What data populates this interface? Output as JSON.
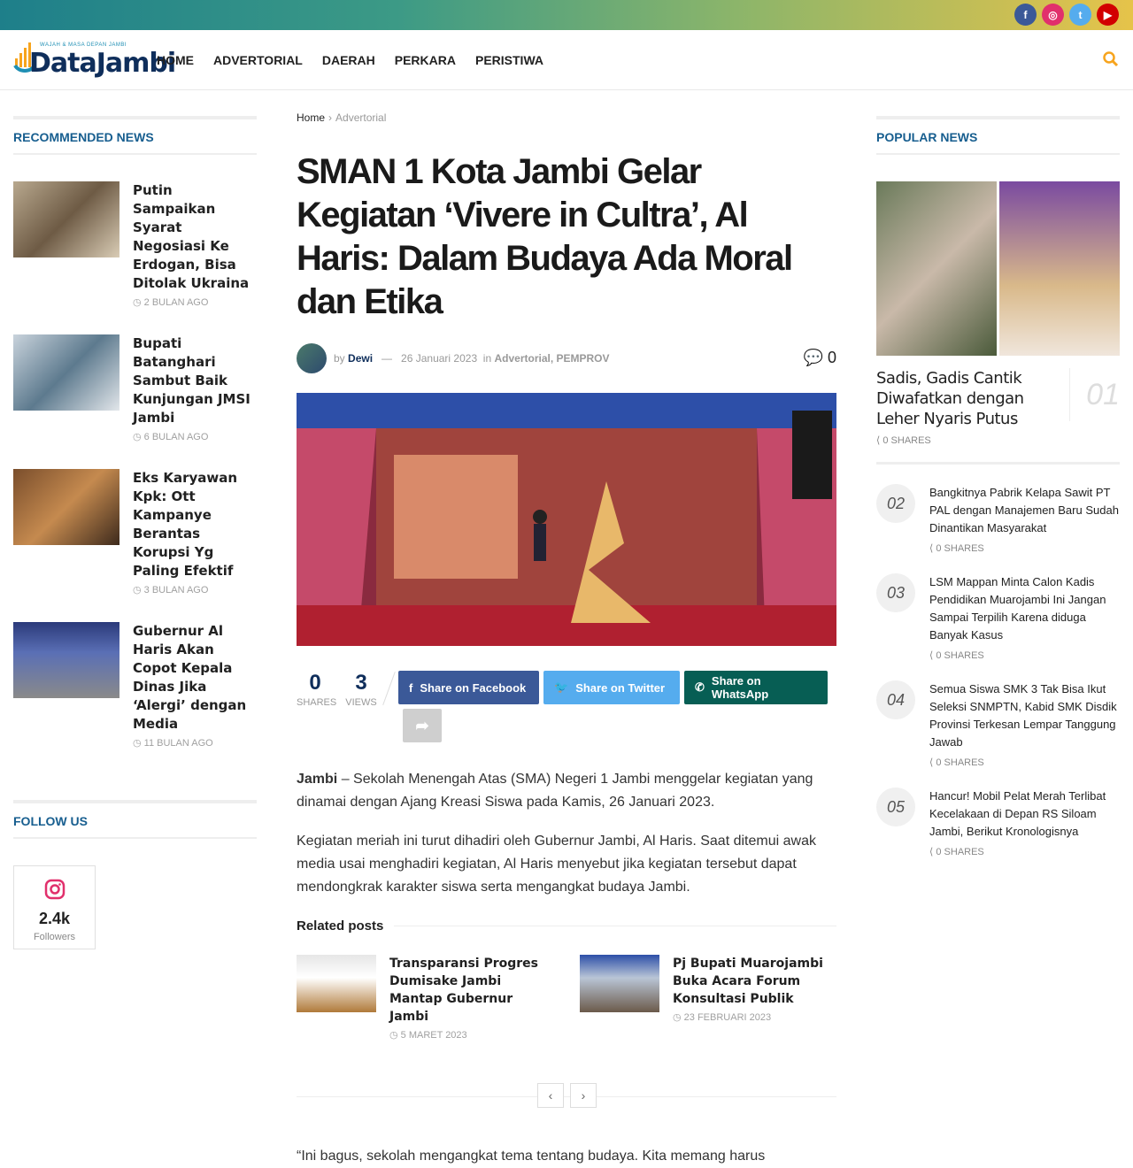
{
  "header": {
    "logo_tagline": "WAJAH & MASA DEPAN JAMBI",
    "logo_name": "DataJambi",
    "nav": [
      "HOME",
      "ADVERTORIAL",
      "DAERAH",
      "PERKARA",
      "PERISTIWA"
    ],
    "socials": [
      "facebook-icon",
      "instagram-icon",
      "twitter-icon",
      "youtube-icon"
    ]
  },
  "left": {
    "recommended_title": "RECOMMENDED NEWS",
    "items": [
      {
        "title": "Putin Sampaikan Syarat Negosiasi Ke Erdogan, Bisa Ditolak Ukraina",
        "date": "2 BULAN AGO"
      },
      {
        "title": "Bupati Batanghari Sambut Baik Kunjungan JMSI Jambi",
        "date": "6 BULAN AGO"
      },
      {
        "title": "Eks Karyawan Kpk: Ott Kampanye Berantas Korupsi Yg Paling Efektif",
        "date": "3 BULAN AGO"
      },
      {
        "title": "Gubernur Al Haris Akan Copot Kepala Dinas Jika ‘Alergi’ dengan Media",
        "date": "11 BULAN AGO"
      }
    ],
    "follow_title": "FOLLOW US",
    "ig_count": "2.4k",
    "ig_label": "Followers"
  },
  "article": {
    "breadcrumb_home": "Home",
    "breadcrumb_current": "Advertorial",
    "title": "SMAN 1 Kota Jambi Gelar Kegiatan ‘Vivere in Cultra’, Al Haris: Dalam Budaya Ada Moral dan Etika",
    "by": "by",
    "author": "Dewi",
    "date": "26 Januari 2023",
    "in": "in",
    "categories": "Advertorial, PEMPROV",
    "comments": "0",
    "shares_count": "0",
    "shares_label": "SHARES",
    "views_count": "3",
    "views_label": "VIEWS",
    "share_facebook": "Share on Facebook",
    "share_twitter": "Share on Twitter",
    "share_whatsapp": "Share on WhatsApp",
    "p1_bold": "Jambi",
    "p1": " – Sekolah Menengah Atas (SMA) Negeri 1 Jambi menggelar kegiatan yang dinamai dengan Ajang Kreasi Siswa pada Kamis, 26 Januari 2023.",
    "p2": "Kegiatan meriah ini turut dihadiri oleh Gubernur Jambi, Al Haris. Saat ditemui awak media usai menghadiri kegiatan, Al Haris menyebut jika kegiatan tersebut dapat mendongkrak karakter siswa serta mengangkat budaya Jambi.",
    "related_title": "Related posts",
    "related": [
      {
        "title": "Transparansi Progres Dumisake Jambi Mantap Gubernur Jambi",
        "date": "5 MARET 2023"
      },
      {
        "title": "Pj Bupati Muarojambi Buka Acara Forum Konsultasi Publik",
        "date": "23 FEBRUARI 2023"
      }
    ],
    "p3": "“Ini bagus, sekolah mengangkat tema tentang budaya. Kita memang harus"
  },
  "right": {
    "popular_title": "POPULAR NEWS",
    "first": {
      "title": "Sadis, Gadis Cantik Diwafatkan dengan Leher Nyaris Putus",
      "num": "01",
      "shares": "0 SHARES"
    },
    "items": [
      {
        "num": "02",
        "title": "Bangkitnya Pabrik Kelapa Sawit PT PAL dengan Manajemen Baru Sudah Dinantikan Masyarakat",
        "shares": "0 SHARES"
      },
      {
        "num": "03",
        "title": "LSM Mappan Minta Calon Kadis Pendidikan Muarojambi Ini Jangan Sampai Terpilih Karena diduga Banyak Kasus",
        "shares": "0 SHARES"
      },
      {
        "num": "04",
        "title": "Semua Siswa SMK 3 Tak Bisa Ikut Seleksi SNMPTN, Kabid SMK Disdik Provinsi Terkesan Lempar Tanggung Jawab",
        "shares": "0 SHARES"
      },
      {
        "num": "05",
        "title": "Hancur! Mobil Pelat Merah Terlibat Kecelakaan di Depan RS Siloam Jambi, Berikut Kronologisnya",
        "shares": "0 SHARES"
      }
    ]
  }
}
